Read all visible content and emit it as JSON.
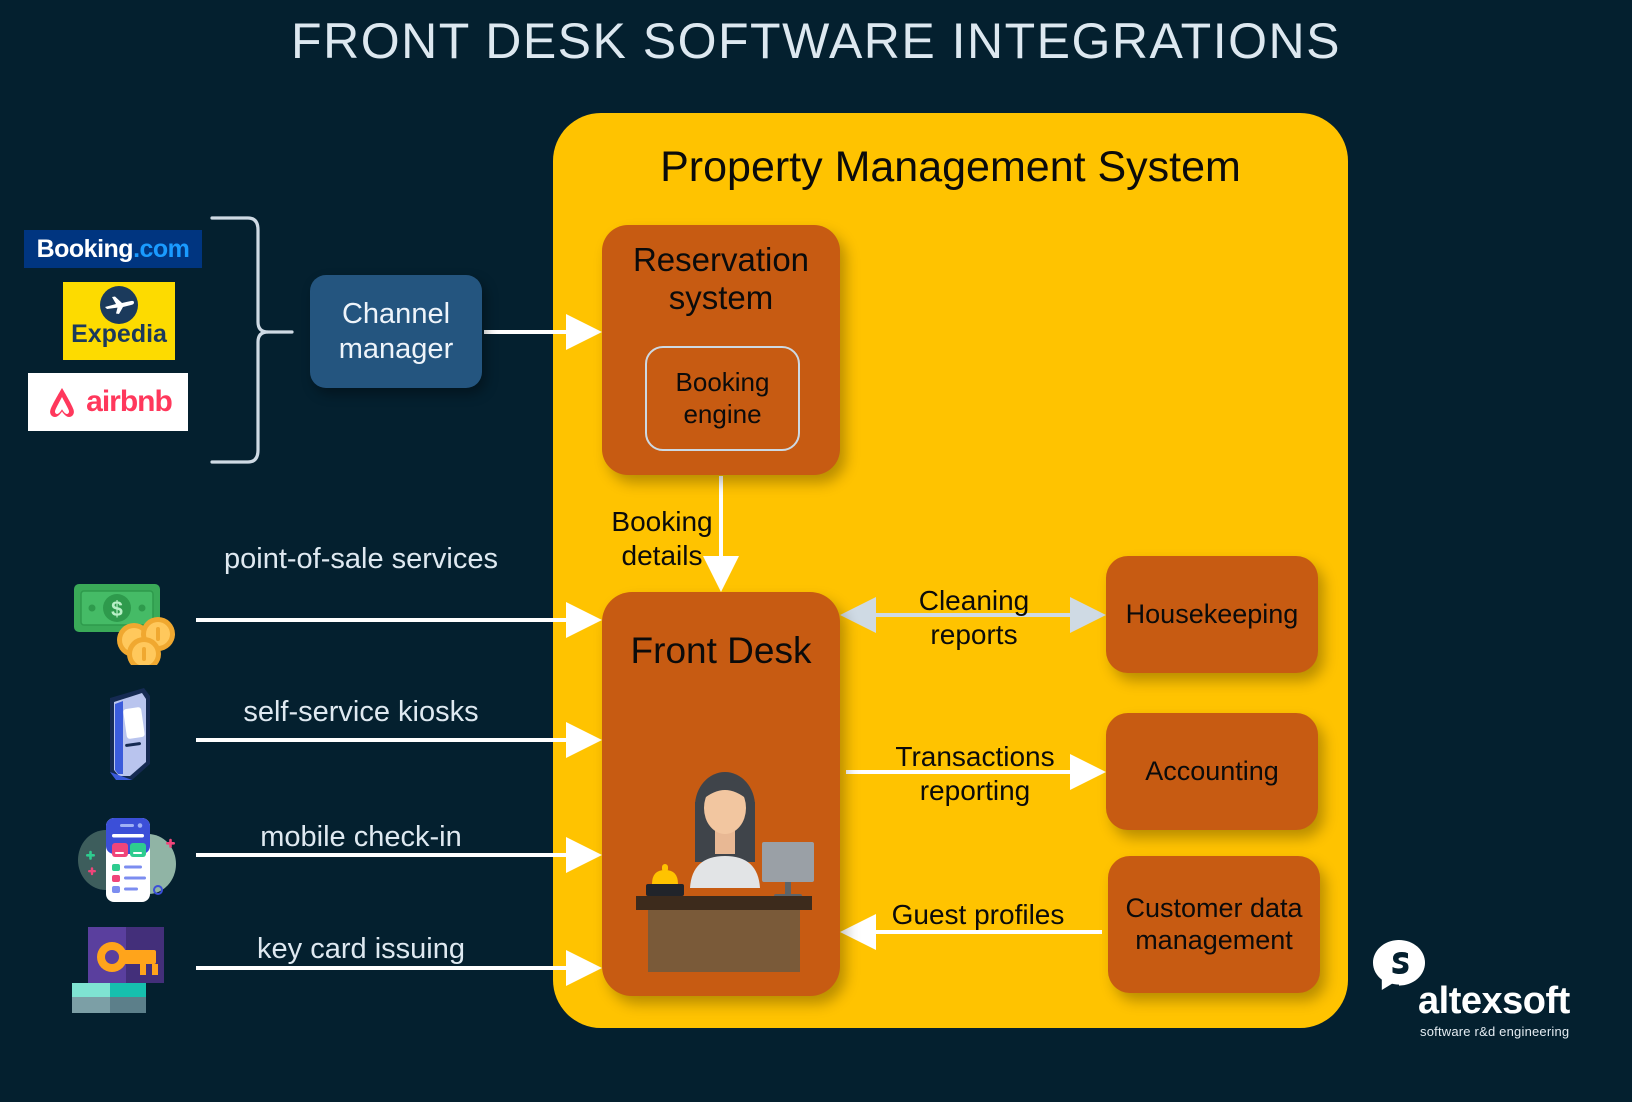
{
  "title": "FRONT DESK SOFTWARE INTEGRATIONS",
  "colors": {
    "background": "#04202f",
    "pms_yellow": "#ffc300",
    "module_orange": "#c75b12",
    "channel_blue": "#24557f",
    "text_light": "#dfe9f1",
    "text_dark": "#0b0b0b",
    "arrow_white": "#ffffff",
    "arrow_grey": "#cdd9e3"
  },
  "pms": {
    "title": "Property Management System",
    "reservation_system": {
      "label": "Reservation system",
      "booking_engine": "Booking engine"
    },
    "front_desk": {
      "label": "Front Desk",
      "illustration": "receptionist-at-desk-illustration"
    },
    "modules": [
      {
        "label": "Housekeeping"
      },
      {
        "label": "Accounting"
      },
      {
        "label": "Customer data management"
      }
    ],
    "internal_flows": [
      {
        "label": "Booking details",
        "from": "Reservation system",
        "to": "Front Desk",
        "direction": "down"
      },
      {
        "label": "Cleaning reports",
        "from": "Front Desk",
        "to": "Housekeeping",
        "direction": "both"
      },
      {
        "label": "Transactions reporting",
        "from": "Front Desk",
        "to": "Accounting",
        "direction": "right"
      },
      {
        "label": "Guest profiles",
        "from": "Customer data management",
        "to": "Front Desk",
        "direction": "left"
      }
    ]
  },
  "channel_manager": {
    "label": "Channel manager"
  },
  "ota_logos": [
    {
      "name": "booking-com-logo",
      "text_primary": "Booking",
      "text_secondary": ".com"
    },
    {
      "name": "expedia-logo",
      "text": "Expedia"
    },
    {
      "name": "airbnb-logo",
      "text": "airbnb"
    }
  ],
  "services": [
    {
      "icon": "cash-and-coins-icon",
      "label": "point-of-sale services"
    },
    {
      "icon": "self-service-kiosk-icon",
      "label": "self-service kiosks"
    },
    {
      "icon": "mobile-phone-app-icon",
      "label": "mobile check-in"
    },
    {
      "icon": "key-card-icon",
      "label": "key card issuing"
    }
  ],
  "brand": {
    "name": "altexsoft",
    "tagline": "software r&d engineering"
  }
}
